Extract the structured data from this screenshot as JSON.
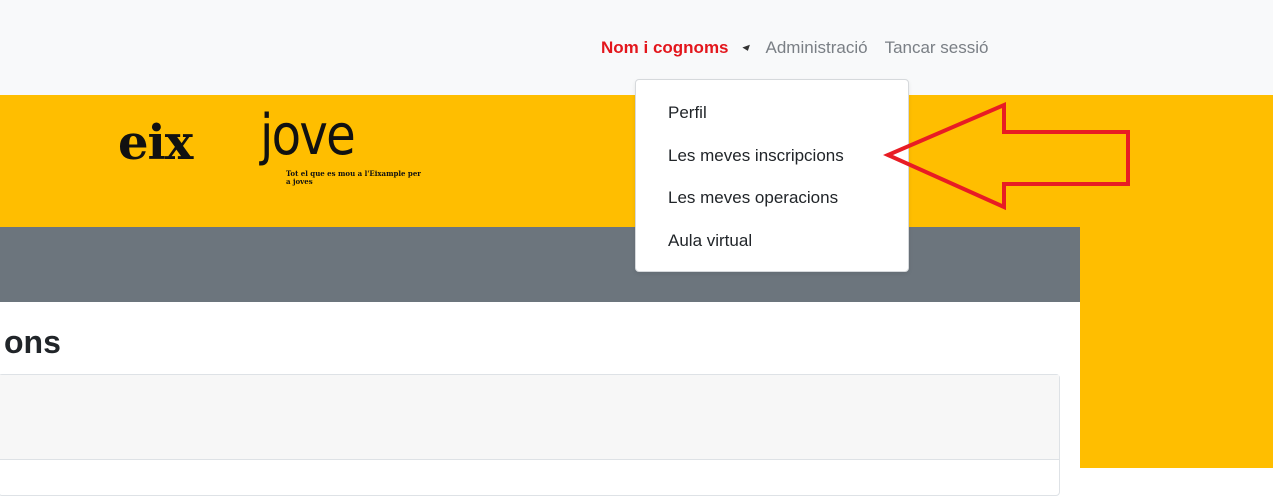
{
  "topnav": {
    "user_name": "Nom i cognoms",
    "admin_link": "Administració",
    "logout_link": "Tancar sessió"
  },
  "logo": {
    "wordmark_bold": "eix",
    "wordmark_light": "jove",
    "tagline": "Tot el que es mou a l'Eixample per a joves"
  },
  "page": {
    "title_fragment": "ons"
  },
  "dropdown": {
    "items": [
      {
        "label": "Perfil"
      },
      {
        "label": "Les meves inscripcions"
      },
      {
        "label": "Les meves operacions"
      },
      {
        "label": "Aula virtual"
      }
    ]
  },
  "colors": {
    "brand_yellow": "#ffbe00",
    "grey_bar": "#6c757d",
    "user_red": "#e3161c",
    "annotation_arrow": "#e81c24"
  }
}
